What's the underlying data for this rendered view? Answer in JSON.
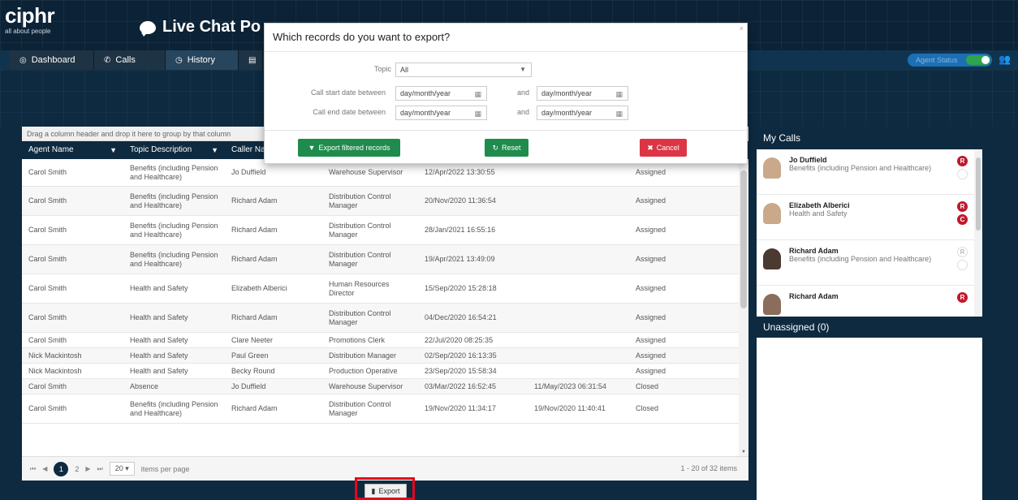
{
  "header": {
    "brand": "ciphr",
    "tagline": "all about people",
    "app_title": "Live Chat Po"
  },
  "nav": {
    "tabs": [
      {
        "label": "Dashboard",
        "icon": "dashboard-icon"
      },
      {
        "label": "Calls",
        "icon": "phone-icon"
      },
      {
        "label": "History",
        "icon": "history-icon"
      }
    ],
    "agent_status_label": "Agent Status"
  },
  "grid": {
    "group_hint": "Drag a column header and drop it here to group by that column",
    "columns": [
      "Agent Name",
      "Topic Description",
      "Caller Na"
    ],
    "rows": [
      {
        "agent": "Carol Smith",
        "topic": "Benefits (including Pension and Healthcare)",
        "caller": "Jo Duffield",
        "role": "Warehouse Supervisor",
        "start": "12/Apr/2022 13:30:55",
        "end": "",
        "status": "Assigned"
      },
      {
        "agent": "Carol Smith",
        "topic": "Benefits (including Pension and Healthcare)",
        "caller": "Richard Adam",
        "role": "Distribution Control Manager",
        "start": "20/Nov/2020 11:36:54",
        "end": "",
        "status": "Assigned"
      },
      {
        "agent": "Carol Smith",
        "topic": "Benefits (including Pension and Healthcare)",
        "caller": "Richard Adam",
        "role": "Distribution Control Manager",
        "start": "28/Jan/2021 16:55:16",
        "end": "",
        "status": "Assigned"
      },
      {
        "agent": "Carol Smith",
        "topic": "Benefits (including Pension and Healthcare)",
        "caller": "Richard Adam",
        "role": "Distribution Control Manager",
        "start": "19/Apr/2021 13:49:09",
        "end": "",
        "status": "Assigned"
      },
      {
        "agent": "Carol Smith",
        "topic": "Health and Safety",
        "caller": "Elizabeth Alberici",
        "role": "Human Resources Director",
        "start": "15/Sep/2020 15:28:18",
        "end": "",
        "status": "Assigned"
      },
      {
        "agent": "Carol Smith",
        "topic": "Health and Safety",
        "caller": "Richard Adam",
        "role": "Distribution Control Manager",
        "start": "04/Dec/2020 16:54:21",
        "end": "",
        "status": "Assigned"
      },
      {
        "agent": "Carol Smith",
        "topic": "Health and Safety",
        "caller": "Clare Neeter",
        "role": "Promotions Clerk",
        "start": "22/Jul/2020 08:25:35",
        "end": "",
        "status": "Assigned"
      },
      {
        "agent": "Nick Mackintosh",
        "topic": "Health and Safety",
        "caller": "Paul Green",
        "role": "Distribution Manager",
        "start": "02/Sep/2020 16:13:35",
        "end": "",
        "status": "Assigned"
      },
      {
        "agent": "Nick Mackintosh",
        "topic": "Health and Safety",
        "caller": "Becky Round",
        "role": "Production Operative",
        "start": "23/Sep/2020 15:58:34",
        "end": "",
        "status": "Assigned"
      },
      {
        "agent": "Carol Smith",
        "topic": "Absence",
        "caller": "Jo Duffield",
        "role": "Warehouse Supervisor",
        "start": "03/Mar/2022 16:52:45",
        "end": "11/May/2023 06:31:54",
        "status": "Closed"
      },
      {
        "agent": "Carol Smith",
        "topic": "Benefits (including Pension and Healthcare)",
        "caller": "Richard Adam",
        "role": "Distribution Control Manager",
        "start": "19/Nov/2020 11:34:17",
        "end": "19/Nov/2020 11:40:41",
        "status": "Closed"
      }
    ],
    "pager": {
      "first": "⏮",
      "prev": "◀",
      "current_page": "1",
      "next_page": "2",
      "next": "▶",
      "last": "⏭",
      "page_size": "20",
      "items_per_page": "items per page",
      "count": "1 - 20 of 32 items"
    },
    "export_label": "Export"
  },
  "my_calls": {
    "title": "My Calls",
    "items": [
      {
        "name": "Jo Duffield",
        "topic": "Benefits (including Pension and Healthcare)",
        "badges": [
          "R",
          ""
        ]
      },
      {
        "name": "Elizabeth Alberici",
        "topic": "Health and Safety",
        "badges": [
          "R",
          "C"
        ]
      },
      {
        "name": "Richard Adam",
        "topic": "Benefits (including Pension and Healthcare)",
        "badges": [
          "R",
          ""
        ]
      },
      {
        "name": "Richard Adam",
        "topic": "",
        "badges": [
          "R"
        ]
      }
    ]
  },
  "unassigned": {
    "title": "Unassigned (0)"
  },
  "modal": {
    "title": "Which records do you want to export?",
    "topic_label": "Topic",
    "topic_value": "All",
    "call_start_label": "Call start date between",
    "call_end_label": "Call end date between",
    "and_label": "and",
    "date_placeholder": "day/month/year",
    "export_filtered_label": "Export filtered records",
    "reset_label": "Reset",
    "cancel_label": "Cancel"
  },
  "colors": {
    "navy": "#0e2a40",
    "accent_green": "#1f8b4c",
    "cancel_red": "#dc3545",
    "highlight": "#e4061b"
  }
}
